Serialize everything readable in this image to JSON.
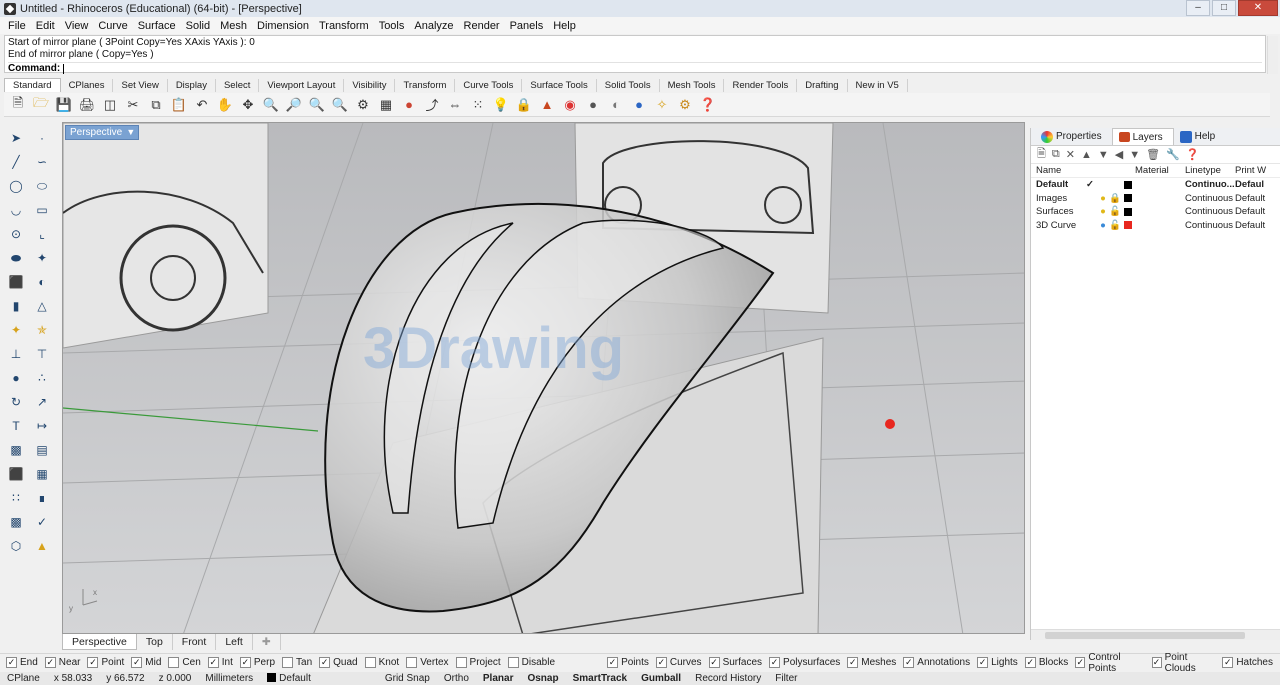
{
  "window": {
    "title": "Untitled - Rhinoceros (Educational) (64-bit) - [Perspective]"
  },
  "menu": [
    "File",
    "Edit",
    "View",
    "Curve",
    "Surface",
    "Solid",
    "Mesh",
    "Dimension",
    "Transform",
    "Tools",
    "Analyze",
    "Render",
    "Panels",
    "Help"
  ],
  "command": {
    "history": [
      "Start of mirror plane ( 3Point  Copy=Yes  XAxis  YAxis ): 0",
      "End of mirror plane ( Copy=Yes )"
    ],
    "prompt": "Command:"
  },
  "toolbar_tabs": [
    "Standard",
    "CPlanes",
    "Set View",
    "Display",
    "Select",
    "Viewport Layout",
    "Visibility",
    "Transform",
    "Curve Tools",
    "Surface Tools",
    "Solid Tools",
    "Mesh Tools",
    "Render Tools",
    "Drafting",
    "New in V5"
  ],
  "viewport": {
    "label": "Perspective",
    "watermark": "3Drawing"
  },
  "view_tabs": [
    "Perspective",
    "Top",
    "Front",
    "Left"
  ],
  "panel": {
    "tabs": [
      "Properties",
      "Layers",
      "Help"
    ],
    "columns": {
      "name": "Name",
      "material": "Material",
      "linetype": "Linetype",
      "print": "Print W"
    },
    "layers": [
      {
        "name": "Default",
        "current": "✓",
        "color": "#000000",
        "linetype": "Continuo...",
        "print": "Defaul"
      },
      {
        "name": "Images",
        "current": "",
        "color": "#000000",
        "linetype": "Continuous",
        "print": "Default"
      },
      {
        "name": "Surfaces",
        "current": "",
        "color": "#000000",
        "linetype": "Continuous",
        "print": "Default"
      },
      {
        "name": "3D Curve",
        "current": "",
        "color": "#e8271f",
        "linetype": "Continuous",
        "print": "Default"
      }
    ]
  },
  "osnaps": [
    {
      "label": "End",
      "on": true
    },
    {
      "label": "Near",
      "on": true
    },
    {
      "label": "Point",
      "on": true
    },
    {
      "label": "Mid",
      "on": true
    },
    {
      "label": "Cen",
      "on": false
    },
    {
      "label": "Int",
      "on": true
    },
    {
      "label": "Perp",
      "on": true
    },
    {
      "label": "Tan",
      "on": false
    },
    {
      "label": "Quad",
      "on": true
    },
    {
      "label": "Knot",
      "on": false
    },
    {
      "label": "Vertex",
      "on": false
    },
    {
      "label": "Project",
      "on": false
    },
    {
      "label": "Disable",
      "on": false
    }
  ],
  "filters": [
    {
      "label": "Points",
      "on": true
    },
    {
      "label": "Curves",
      "on": true
    },
    {
      "label": "Surfaces",
      "on": true
    },
    {
      "label": "Polysurfaces",
      "on": true
    },
    {
      "label": "Meshes",
      "on": true
    },
    {
      "label": "Annotations",
      "on": true
    },
    {
      "label": "Lights",
      "on": true
    },
    {
      "label": "Blocks",
      "on": true
    },
    {
      "label": "Control Points",
      "on": true
    },
    {
      "label": "Point Clouds",
      "on": true
    },
    {
      "label": "Hatches",
      "on": true
    }
  ],
  "status": {
    "cplane": "CPlane",
    "x": "x 58.033",
    "y": "y 66.572",
    "z": "z 0.000",
    "units": "Millimeters",
    "layer": "Default",
    "grid_snap": "Grid Snap",
    "ortho": "Ortho",
    "planar": "Planar",
    "osnap": "Osnap",
    "smarttrack": "SmartTrack",
    "gumball": "Gumball",
    "record": "Record History",
    "filter": "Filter"
  }
}
